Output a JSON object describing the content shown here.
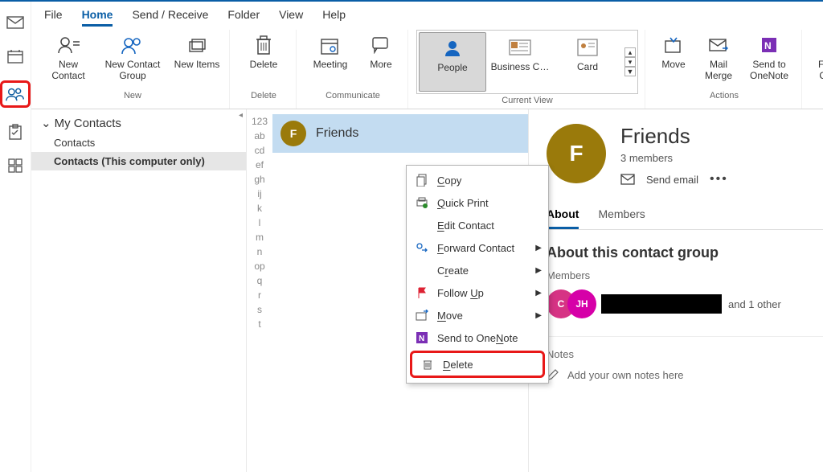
{
  "menubar": {
    "file": "File",
    "home": "Home",
    "sendreceive": "Send / Receive",
    "folder": "Folder",
    "view": "View",
    "help": "Help"
  },
  "ribbon": {
    "new": {
      "contact": "New Contact",
      "group": "New Contact Group",
      "items": "New Items ",
      "label": "New"
    },
    "delete": {
      "delete": "Delete",
      "label": "Delete"
    },
    "communicate": {
      "meeting": "Meeting",
      "more": "More ",
      "label": "Communicate"
    },
    "currentview": {
      "people": "People",
      "business": "Business C…",
      "card": "Card",
      "label": "Current View"
    },
    "actions": {
      "move": "Move ",
      "mailmerge": "Mail Merge",
      "sendonenote": "Send to OneNote",
      "label": "Actions"
    },
    "forward": {
      "forward": "Forward Contact "
    }
  },
  "nav": {
    "mycontacts": "My Contacts",
    "contacts": "Contacts",
    "contactslocal": "Contacts (This computer only)"
  },
  "alpha": [
    "123",
    "ab",
    "cd",
    "ef",
    "gh",
    "ij",
    "k",
    "l",
    "m",
    "n",
    "op",
    "q",
    "r",
    "s",
    "t"
  ],
  "list": {
    "item": "Friends",
    "initial": "F"
  },
  "context": {
    "copy": "Copy",
    "quickprint": "Quick Print",
    "editcontact": "Edit Contact",
    "forward": "Forward Contact",
    "create": "Create",
    "followup": "Follow Up",
    "move": "Move",
    "onenote": "Send to OneNote",
    "delete": "Delete"
  },
  "reading": {
    "title": "Friends",
    "initial": "F",
    "members": "3 members",
    "sendemail": "Send email",
    "tab_about": "About",
    "tab_members": "Members",
    "section": "About this contact group",
    "members_label": "Members",
    "other": "and 1 other",
    "notes": "Notes",
    "notes_hint": "Add your own notes here",
    "avatar_c": "C",
    "avatar_j": "JH"
  }
}
